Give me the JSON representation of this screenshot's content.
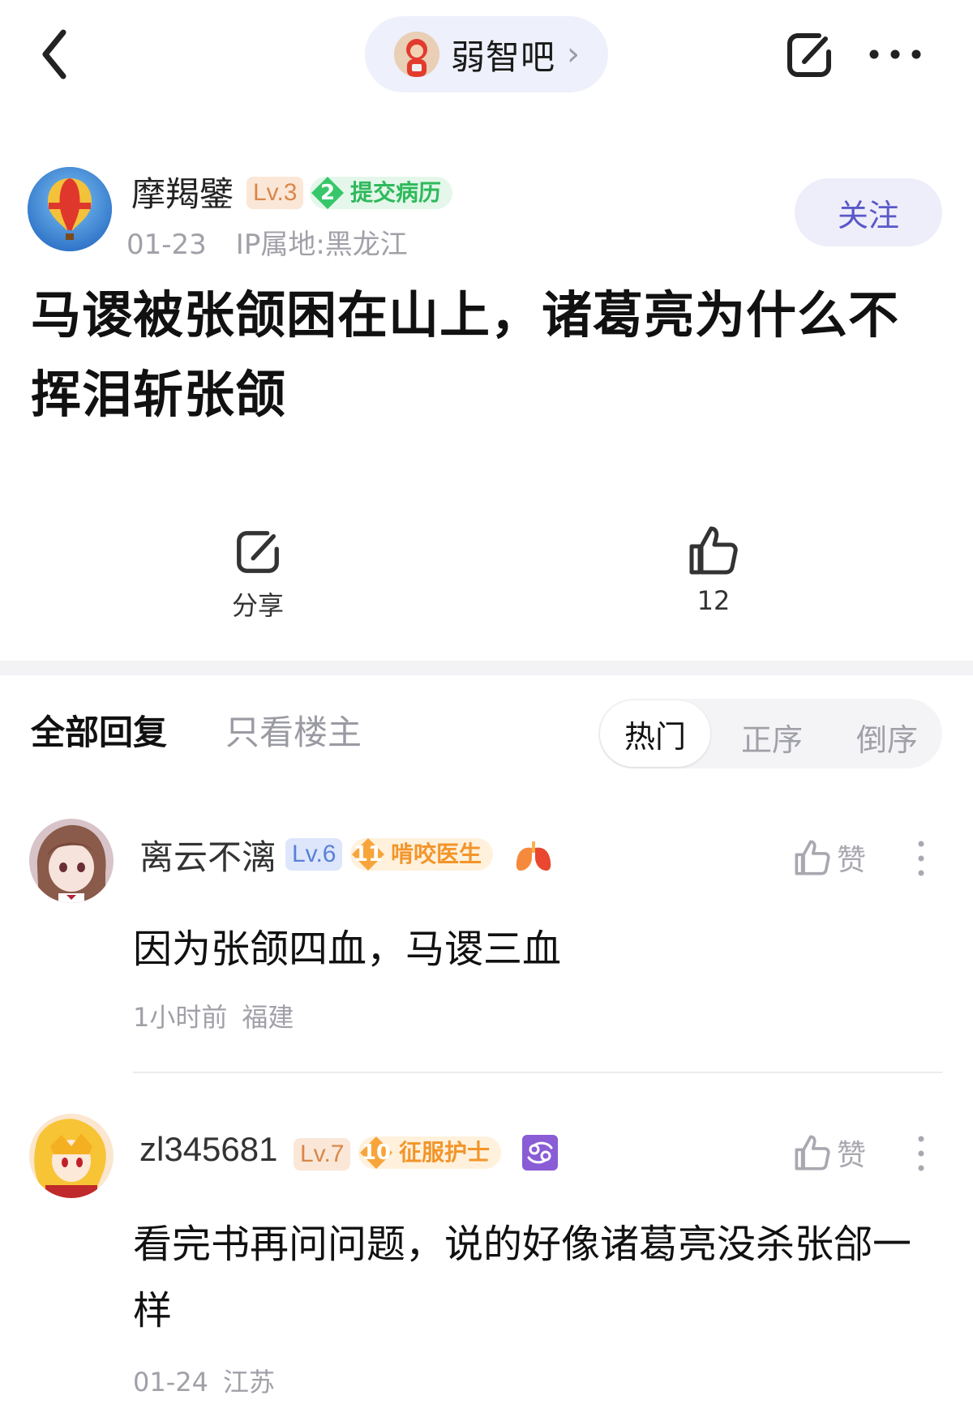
{
  "forum": {
    "name": "弱智吧",
    "chevron": "›"
  },
  "post": {
    "author": "摩羯鐾",
    "level": "Lv.3",
    "title_badge_num": "2",
    "title_badge": "提交病历",
    "date": "01-23",
    "ip": "IP属地:黑龙江",
    "follow_label": "关注",
    "title": "马谡被张颌困在山上，诸葛亮为什么不挥泪斩张颌",
    "share_label": "分享",
    "like_count": "12"
  },
  "tabs": {
    "all": "全部回复",
    "op_only": "只看楼主"
  },
  "sort": {
    "hot": "热门",
    "asc": "正序",
    "desc": "倒序"
  },
  "comments": [
    {
      "user": "离云不漓",
      "level": "Lv.6",
      "badge_num": "11",
      "badge": "啃咬医生",
      "like_label": "赞",
      "text": "因为张颌四血，马谡三血",
      "time": "1小时前",
      "location": "福建"
    },
    {
      "user": "zl345681",
      "level": "Lv.7",
      "badge_num": "10",
      "badge": "征服护士",
      "like_label": "赞",
      "text": "看完书再问问题，说的好像诸葛亮没杀张郃一样",
      "time": "01-24",
      "location": "江苏"
    }
  ],
  "colors": {
    "accent": "#5a58c8",
    "green_badge": "#2fb95c",
    "orange_badge": "#f2952a",
    "zodiac": "#8a5cd6"
  },
  "icons": [
    "back-chevron-icon",
    "forum-avatar-icon",
    "share-icon",
    "more-horizontal-icon",
    "thumbs-up-icon",
    "lungs-icon",
    "cancer-zodiac-icon",
    "more-vertical-icon"
  ]
}
